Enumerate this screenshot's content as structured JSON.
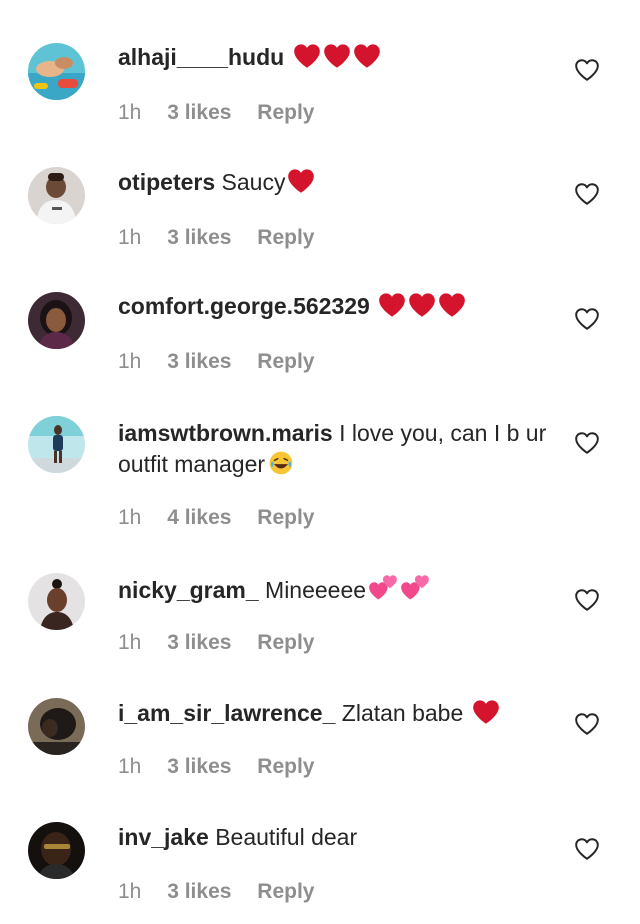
{
  "comments": [
    {
      "username": "alhaji____hudu",
      "text": "",
      "emojis": [
        "red-heart",
        "red-heart",
        "red-heart"
      ],
      "time": "1h",
      "likes": "3 likes",
      "reply": "Reply",
      "avatar": "avatar-pool-photo"
    },
    {
      "username": "otipeters",
      "text": "Saucy",
      "emojis": [
        "red-heart"
      ],
      "time": "1h",
      "likes": "3 likes",
      "reply": "Reply",
      "avatar": "avatar-man-white-shirt"
    },
    {
      "username": "comfort.george.562329",
      "text": "",
      "emojis": [
        "red-heart",
        "red-heart",
        "red-heart"
      ],
      "time": "1h",
      "likes": "3 likes",
      "reply": "Reply",
      "avatar": "avatar-woman-portrait"
    },
    {
      "username": "iamswtbrown.maris",
      "text": "I love you, can I b ur outfit manager",
      "emojis": [
        "laughing-face"
      ],
      "time": "1h",
      "likes": "4 likes",
      "reply": "Reply",
      "avatar": "avatar-standing-figure"
    },
    {
      "username": "nicky_gram_",
      "text": "Mineeeee",
      "emojis": [
        "two-pink-hearts",
        "two-pink-hearts"
      ],
      "time": "1h",
      "likes": "3 likes",
      "reply": "Reply",
      "avatar": "avatar-woman-smiling"
    },
    {
      "username": "i_am_sir_lawrence_",
      "text": "Zlatan babe",
      "emojis": [
        "red-heart"
      ],
      "time": "1h",
      "likes": "3 likes",
      "reply": "Reply",
      "avatar": "avatar-dark-photo"
    },
    {
      "username": "inv_jake",
      "text": "Beautiful dear",
      "emojis": [],
      "time": "1h",
      "likes": "3 likes",
      "reply": "Reply",
      "avatar": "avatar-man-portrait"
    }
  ],
  "colors": {
    "text": "#262626",
    "meta": "#8e8e8e",
    "heart_red": "#d3142c",
    "heart_pink": "#f0488a"
  },
  "icons": {
    "like": "heart-outline-icon"
  }
}
